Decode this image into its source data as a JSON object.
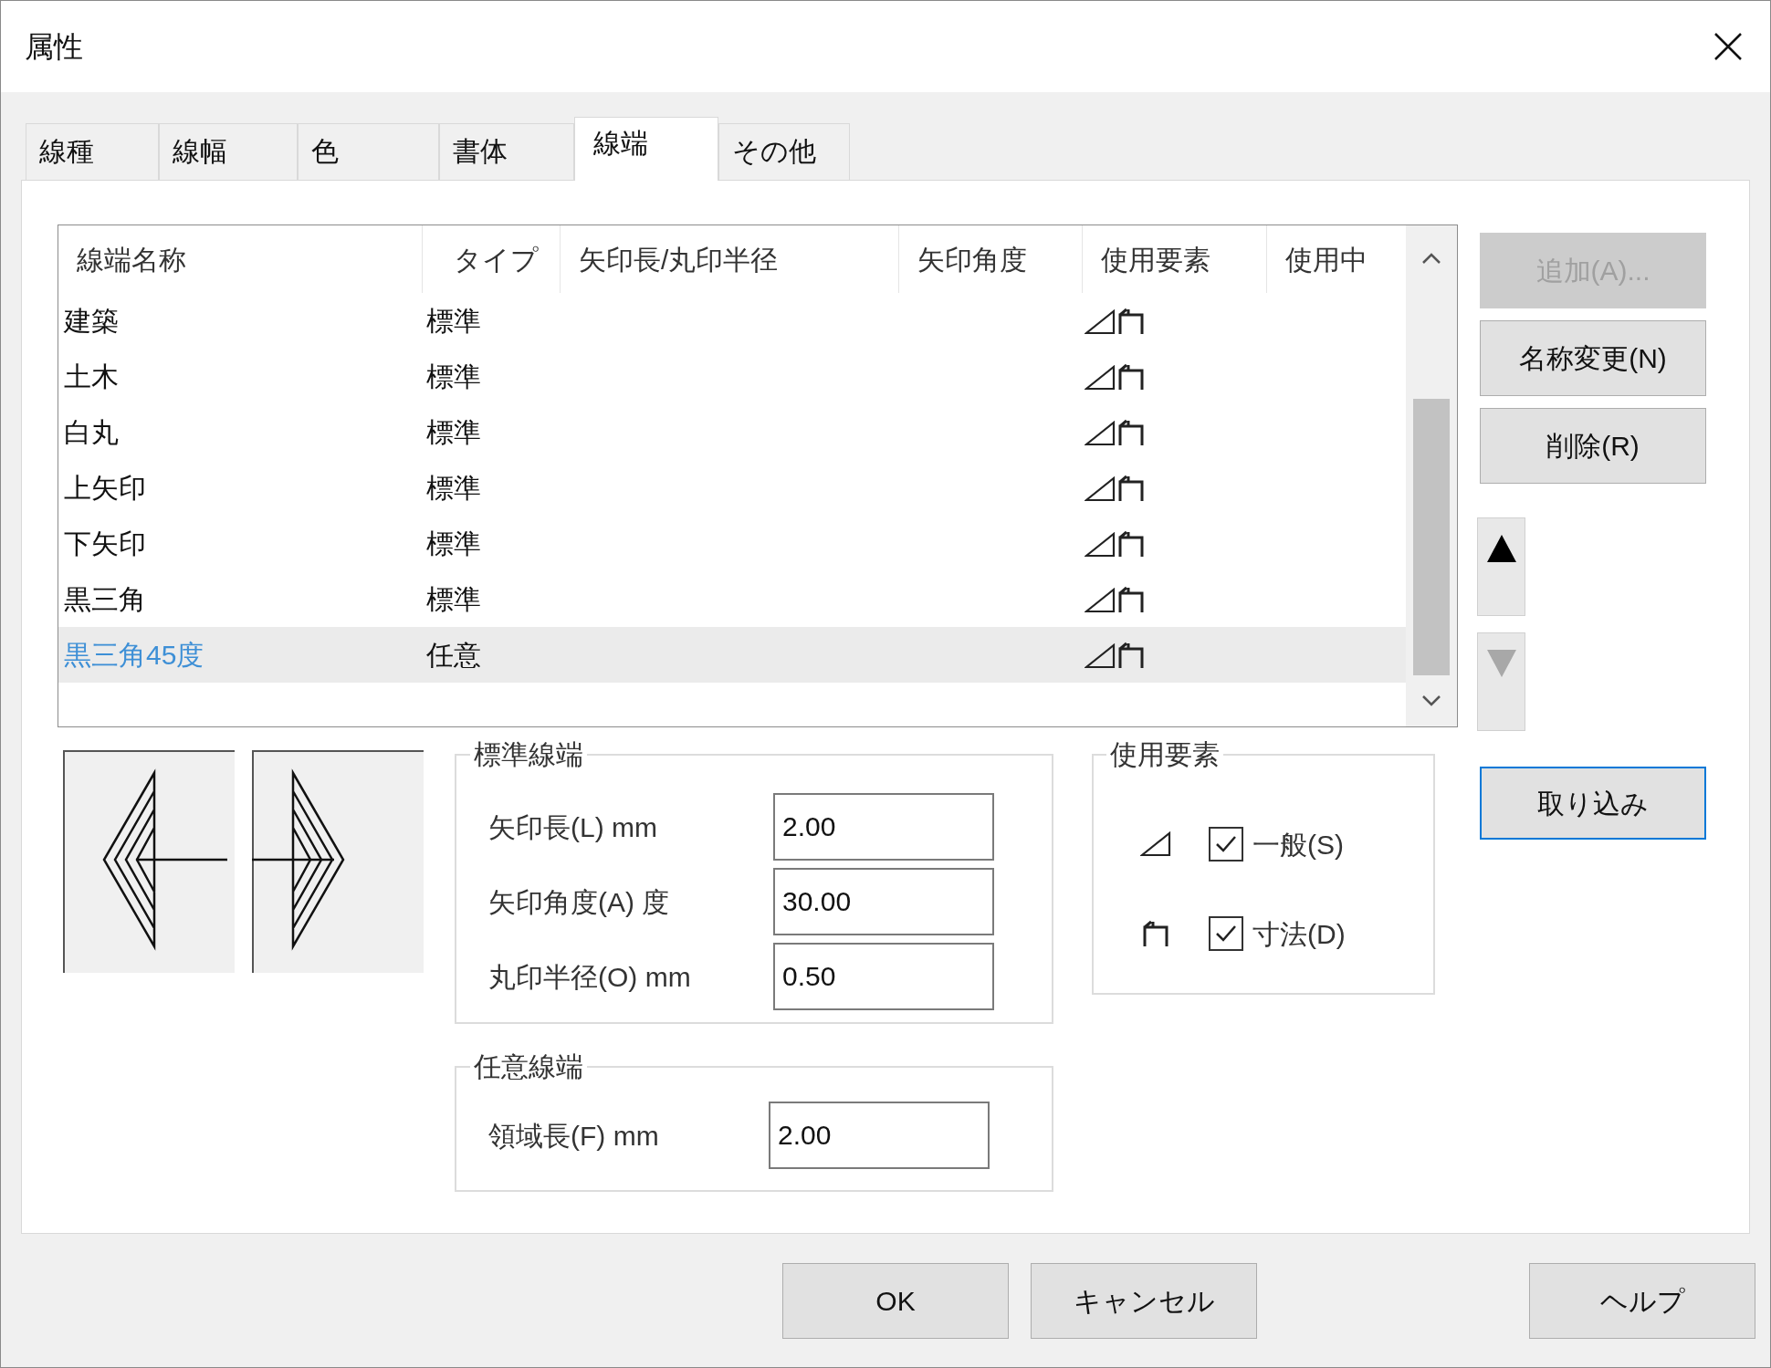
{
  "window": {
    "title": "属性"
  },
  "tabs": [
    {
      "label": "線種",
      "selected": false
    },
    {
      "label": "線幅",
      "selected": false
    },
    {
      "label": "色",
      "selected": false
    },
    {
      "label": "書体",
      "selected": false
    },
    {
      "label": "線端",
      "selected": true
    },
    {
      "label": "その他",
      "selected": false
    }
  ],
  "list": {
    "columns": [
      "線端名称",
      "タイプ",
      "矢印長/丸印半径",
      "矢印角度",
      "使用要素",
      "使用中"
    ],
    "rows": [
      {
        "name": "建築",
        "type": "標準",
        "selected": false
      },
      {
        "name": "土木",
        "type": "標準",
        "selected": false
      },
      {
        "name": "白丸",
        "type": "標準",
        "selected": false
      },
      {
        "name": "上矢印",
        "type": "標準",
        "selected": false
      },
      {
        "name": "下矢印",
        "type": "標準",
        "selected": false
      },
      {
        "name": "黒三角",
        "type": "標準",
        "selected": false
      },
      {
        "name": "黒三角45度",
        "type": "任意",
        "selected": true
      }
    ]
  },
  "buttons": [
    {
      "label": "追加(A)...",
      "disabled": true
    },
    {
      "label": "名称変更(N)",
      "disabled": false
    },
    {
      "label": "削除(R)",
      "disabled": false
    }
  ],
  "order_buttons": [
    {
      "kind": "up",
      "disabled": false
    },
    {
      "kind": "down",
      "disabled": true
    }
  ],
  "import_button": {
    "label": "取り込み",
    "focused": true
  },
  "standard_end": {
    "title": "標準線端",
    "fields": [
      {
        "label": "矢印長(L) mm",
        "value": "2.00"
      },
      {
        "label": "矢印角度(A) 度",
        "value": "30.00"
      },
      {
        "label": "丸印半径(O) mm",
        "value": "0.50"
      }
    ]
  },
  "custom_end": {
    "title": "任意線端",
    "fields": [
      {
        "label": "領域長(F) mm",
        "value": "2.00"
      }
    ]
  },
  "usage": {
    "title": "使用要素",
    "items": [
      {
        "kind": "general",
        "label": "一般(S)",
        "checked": true
      },
      {
        "kind": "dimension",
        "label": "寸法(D)",
        "checked": true
      }
    ]
  },
  "dialog_buttons": [
    {
      "label": "OK"
    },
    {
      "label": "キャンセル"
    },
    {
      "label": "ヘルプ"
    }
  ]
}
